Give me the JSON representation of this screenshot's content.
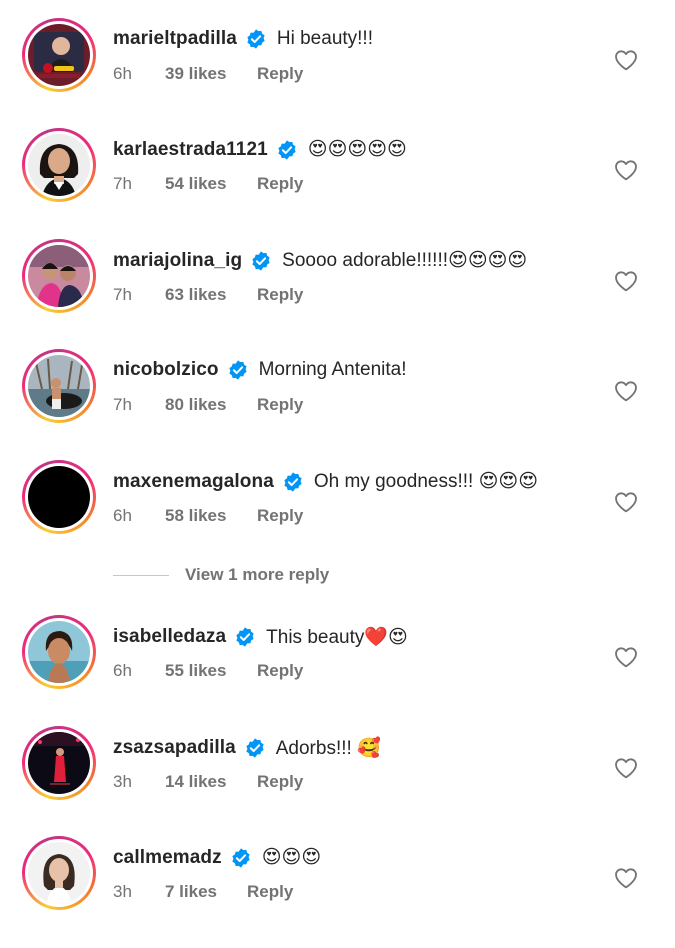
{
  "comments": [
    {
      "username": "marieltpadilla",
      "text": "Hi beauty!!!",
      "time": "6h",
      "likes": "39 likes",
      "reply": "Reply",
      "avatar": "avatar-marieltpadilla"
    },
    {
      "username": "karlaestrada1121",
      "text": "😍😍😍😍😍",
      "time": "7h",
      "likes": "54 likes",
      "reply": "Reply",
      "avatar": "avatar-karlaestrada1121"
    },
    {
      "username": "mariajolina_ig",
      "text": "Soooo adorable!!!!!!😍😍😍😍",
      "time": "7h",
      "likes": "63 likes",
      "reply": "Reply",
      "avatar": "avatar-mariajolina_ig"
    },
    {
      "username": "nicobolzico",
      "text": "Morning Antenita!",
      "time": "7h",
      "likes": "80 likes",
      "reply": "Reply",
      "avatar": "avatar-nicobolzico"
    },
    {
      "username": "maxenemagalona",
      "text": "Oh my goodness!!! 😍😍😍",
      "time": "6h",
      "likes": "58 likes",
      "reply": "Reply",
      "avatar": "avatar-maxenemagalona"
    },
    {
      "username": "isabelledaza",
      "text": "This beauty❤️😍",
      "time": "6h",
      "likes": "55 likes",
      "reply": "Reply",
      "avatar": "avatar-isabelledaza"
    },
    {
      "username": "zsazsapadilla",
      "text": "Adorbs!!! 🥰",
      "time": "3h",
      "likes": "14 likes",
      "reply": "Reply",
      "avatar": "avatar-zsazsapadilla"
    },
    {
      "username": "callmemadz",
      "text": "😍😍😍",
      "time": "3h",
      "likes": "7 likes",
      "reply": "Reply",
      "avatar": "avatar-callmemadz"
    }
  ],
  "view_more": {
    "label": "View 1 more reply"
  },
  "icons": {
    "verified": "verified-badge-icon",
    "like": "heart-outline-icon"
  },
  "colors": {
    "verified_blue": "#0095f6",
    "text_primary": "#262626",
    "text_secondary": "#737373"
  }
}
